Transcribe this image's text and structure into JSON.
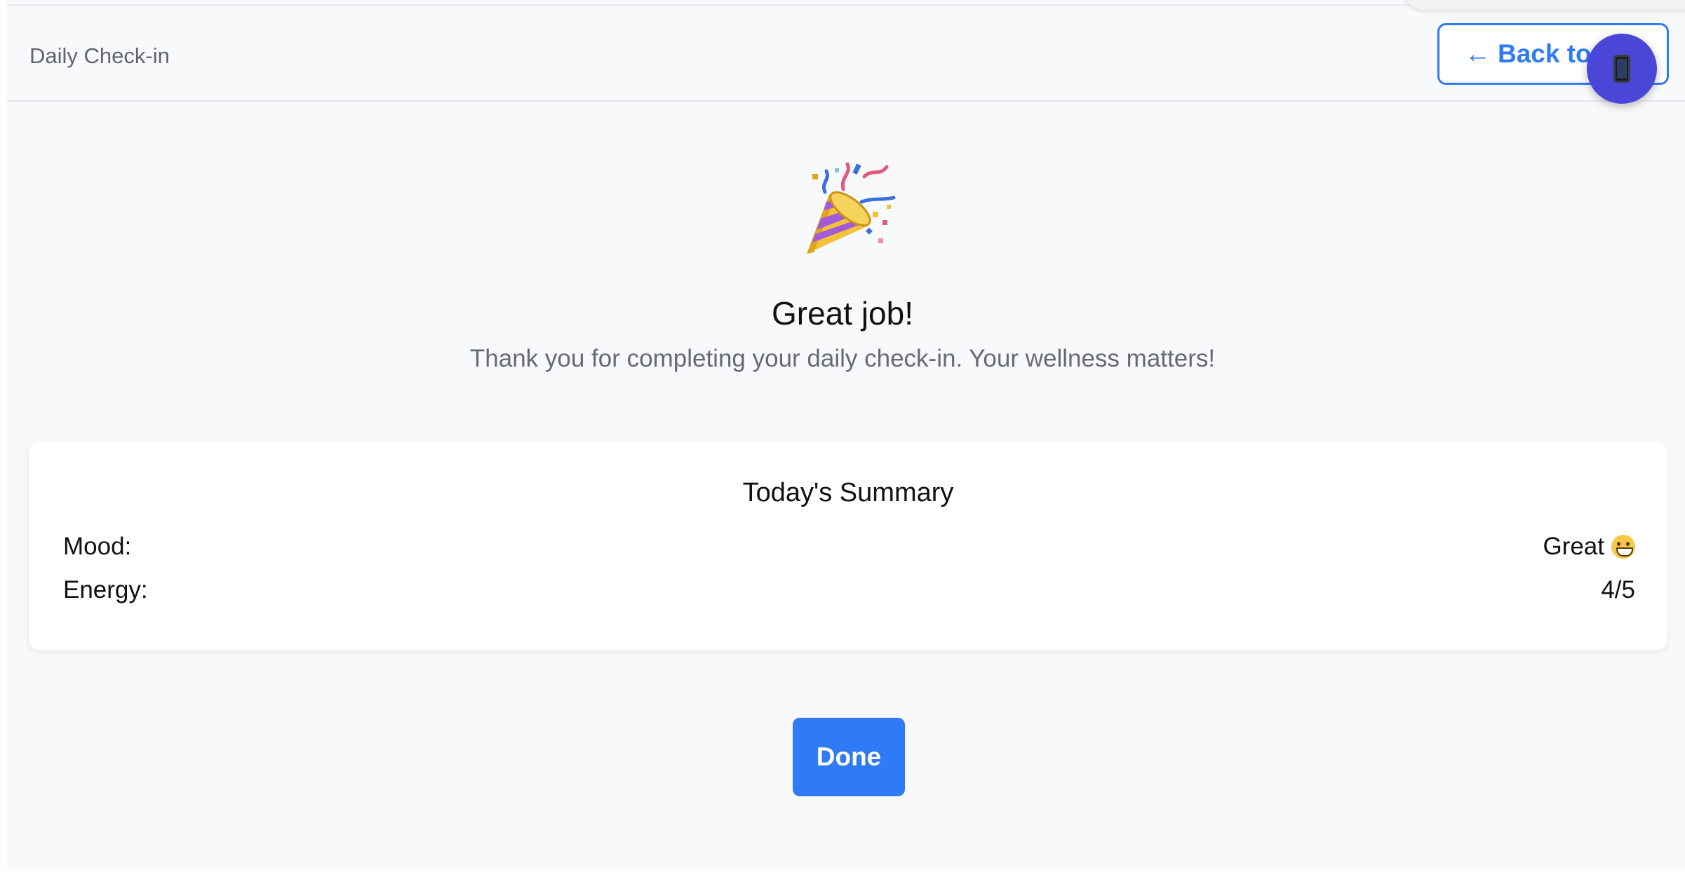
{
  "header": {
    "title": "Daily Check-in",
    "back_label": "Back to M",
    "back_arrow": "←"
  },
  "floating_action": {
    "icon": "mobile-phone-icon"
  },
  "celebration": {
    "icon": "party-popper-icon",
    "heading": "Great job!",
    "subtitle": "Thank you for completing your daily check-in. Your wellness matters!"
  },
  "summary": {
    "title": "Today's Summary",
    "rows": [
      {
        "label": "Mood:",
        "value": "Great",
        "icon": "grinning-face-icon"
      },
      {
        "label": "Energy:",
        "value": "4/5"
      }
    ]
  },
  "actions": {
    "done_label": "Done"
  },
  "colors": {
    "accent": "#2f7bf5",
    "fab": "#4a47d8",
    "background": "#f8f9fb",
    "card": "#ffffff",
    "muted_text": "#656b73"
  }
}
